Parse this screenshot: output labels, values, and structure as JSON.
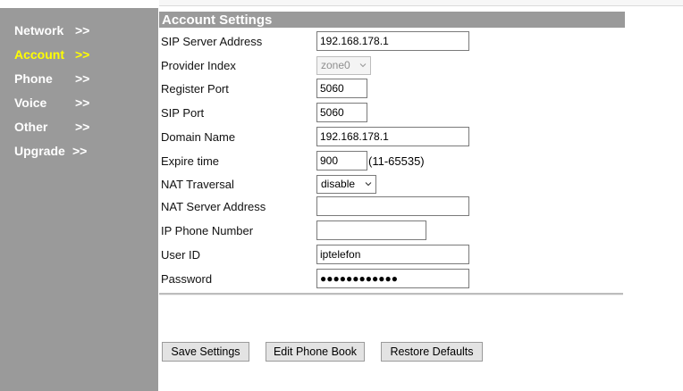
{
  "nav": {
    "items": [
      {
        "label": "Network",
        "arrow": ">>",
        "active": false
      },
      {
        "label": "Account",
        "arrow": ">>",
        "active": true
      },
      {
        "label": "Phone",
        "arrow": ">>",
        "active": false
      },
      {
        "label": "Voice",
        "arrow": ">>",
        "active": false
      },
      {
        "label": "Other",
        "arrow": ">>",
        "active": false
      },
      {
        "label": "Upgrade",
        "arrow": ">>",
        "active": false
      }
    ]
  },
  "section": {
    "title": "Account Settings"
  },
  "form": {
    "sip_server_address": {
      "label": "SIP Server Address",
      "value": "192.168.178.1"
    },
    "provider_index": {
      "label": "Provider Index",
      "value": "zone0"
    },
    "register_port": {
      "label": "Register Port",
      "value": "5060"
    },
    "sip_port": {
      "label": "SIP Port",
      "value": "5060"
    },
    "domain_name": {
      "label": "Domain Name",
      "value": "192.168.178.1"
    },
    "expire_time": {
      "label": "Expire time",
      "value": "900",
      "hint": "(11-65535)"
    },
    "nat_traversal": {
      "label": "NAT Traversal",
      "value": "disable"
    },
    "nat_server_address": {
      "label": "NAT Server Address",
      "value": ""
    },
    "ip_phone_number": {
      "label": "IP Phone Number",
      "value": ""
    },
    "user_id": {
      "label": "User ID",
      "value": "iptelefon"
    },
    "password": {
      "label": "Password",
      "value": "●●●●●●●●●●●●"
    }
  },
  "buttons": {
    "save": "Save Settings",
    "edit_phone_book": "Edit Phone Book",
    "restore_defaults": "Restore Defaults"
  },
  "colors": {
    "sidebar_bg": "#9a9a9a",
    "nav_text": "#ffffff",
    "nav_active": "#ffff00",
    "header_bg": "#9a9a9a"
  }
}
